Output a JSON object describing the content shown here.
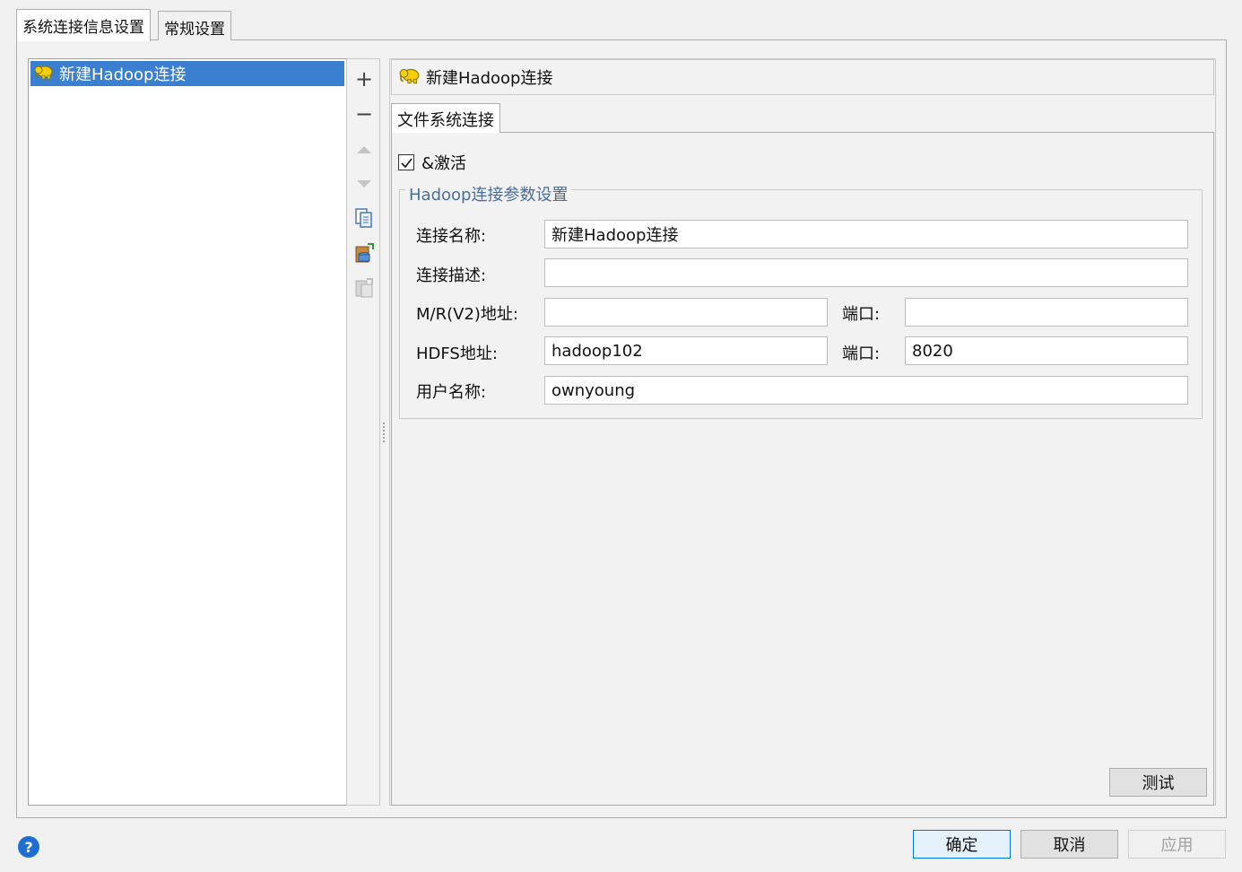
{
  "tabs": [
    {
      "label": "系统连接信息设置",
      "active": true
    },
    {
      "label": "常规设置",
      "active": false
    }
  ],
  "connections": [
    {
      "label": "新建Hadoop连接",
      "selected": true,
      "icon": "hadoop-elephant-icon"
    }
  ],
  "toolbar": {
    "add": "+",
    "remove": "−",
    "icons": [
      "plus-icon",
      "minus-icon",
      "move-up-icon",
      "move-down-icon",
      "copy-icon",
      "import-icon",
      "paste-icon"
    ]
  },
  "detail": {
    "header_title": "新建Hadoop连接",
    "sub_tab": "文件系统连接",
    "activate_label": "&激活",
    "activate_checked": true,
    "group_title": "Hadoop连接参数设置",
    "fields": {
      "name": {
        "label": "连接名称:",
        "value": "新建Hadoop连接"
      },
      "desc": {
        "label": "连接描述:",
        "value": ""
      },
      "mr": {
        "label": "M/R(V2)地址:",
        "value": ""
      },
      "mr_port": {
        "label": "端口:",
        "value": ""
      },
      "hdfs": {
        "label": "HDFS地址:",
        "value": "hadoop102"
      },
      "hdfs_port": {
        "label": "端口:",
        "value": "8020"
      },
      "user": {
        "label": "用户名称:",
        "value": "ownyoung"
      }
    },
    "test_button": "测试"
  },
  "footer": {
    "ok": "确定",
    "cancel": "取消",
    "apply": "应用",
    "help": "?"
  },
  "colors": {
    "selection": "#3a7fd0",
    "group_title": "#4a6e9a",
    "primary_border": "#0078d7",
    "help": "#1e6fd0"
  }
}
